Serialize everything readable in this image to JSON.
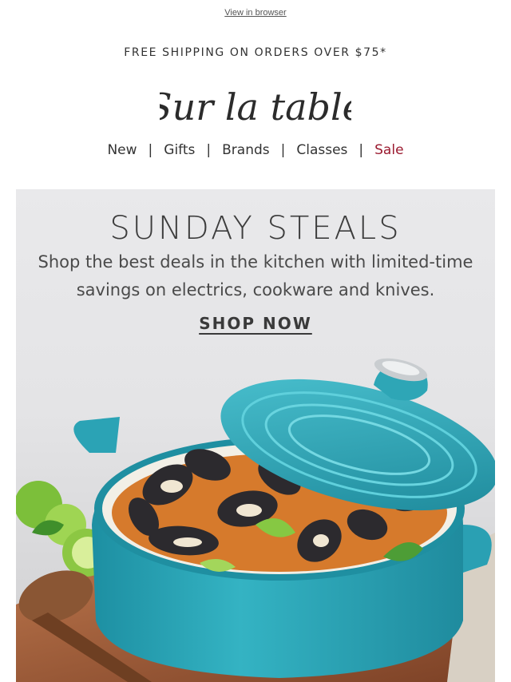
{
  "preheader": {
    "view_in_browser": "View in browser"
  },
  "promo_bar": {
    "text": "FREE SHIPPING ON ORDERS OVER $75*"
  },
  "brand": {
    "logo_text": "Sur la table"
  },
  "nav": {
    "items": [
      {
        "label": "New"
      },
      {
        "label": "Gifts"
      },
      {
        "label": "Brands"
      },
      {
        "label": "Classes"
      },
      {
        "label": "Sale"
      }
    ],
    "separator": "|"
  },
  "hero": {
    "title": "SUNDAY STEALS",
    "subtitle_line1": "Shop the best deals in the kitchen with limited-time",
    "subtitle_line2": "savings on electrics, cookware and knives.",
    "cta": "SHOP NOW",
    "image_icon": "dutch-oven-mussels-image"
  },
  "colors": {
    "sale": "#9b1b30",
    "pot_teal": "#2aa6b8",
    "text": "#333333"
  }
}
